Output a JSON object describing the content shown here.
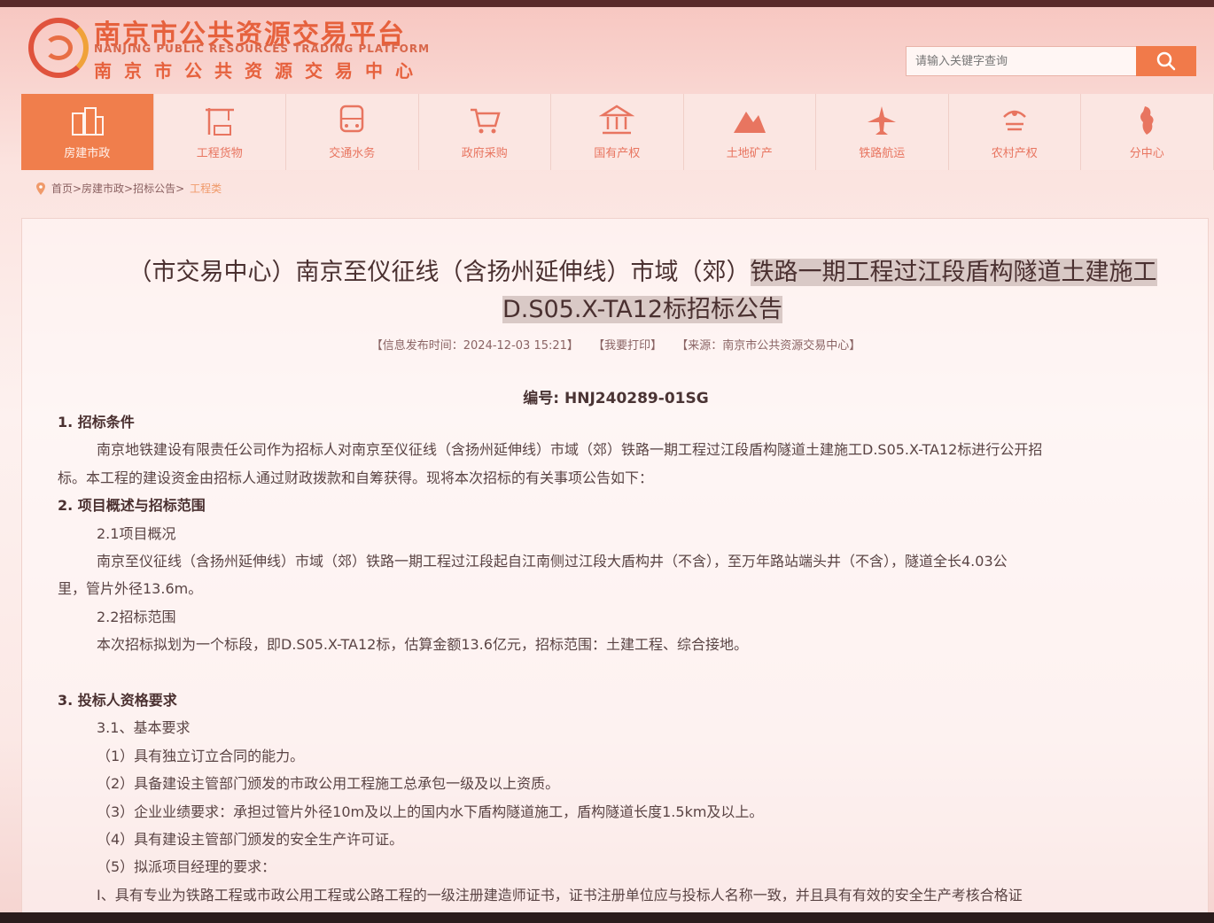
{
  "header": {
    "title_cn": "南京市公共资源交易平台",
    "title_en": "NANJING PUBLIC RESOURCES TRADING PLATFORM",
    "subtitle_cn": "南京市公共资源交易中心",
    "search_placeholder": "请输入关键字查询"
  },
  "nav": {
    "items": [
      {
        "label": "房建市政",
        "icon": "buildings-icon",
        "active": true
      },
      {
        "label": "工程货物",
        "icon": "crane-icon"
      },
      {
        "label": "交通水务",
        "icon": "bus-icon"
      },
      {
        "label": "政府采购",
        "icon": "cart-icon"
      },
      {
        "label": "国有产权",
        "icon": "bank-icon"
      },
      {
        "label": "土地矿产",
        "icon": "mountain-icon"
      },
      {
        "label": "铁路航运",
        "icon": "plane-icon"
      },
      {
        "label": "农村产权",
        "icon": "farm-icon"
      },
      {
        "label": "分中心",
        "icon": "map-icon"
      }
    ]
  },
  "breadcrumb": {
    "path": "首页>房建市政>招标公告>",
    "current": "工程类"
  },
  "article": {
    "title_part1": "（市交易中心）南京至仪征线（含扬州延伸线）市域（郊）",
    "title_part2": "铁路一期工程过江段盾构隧道土建施工",
    "title_part3": "D.S05.X-TA12标招标公告",
    "meta_time": "【信息发布时间：2024-12-03 15:21】",
    "meta_print": "【我要打印】",
    "meta_source": "【来源：南京市公共资源交易中心】",
    "doc_no": "编号: HNJ240289-01SG",
    "lines": [
      {
        "text": "1. 招标条件",
        "type": "h",
        "indent": 0
      },
      {
        "text": "南京地铁建设有限责任公司作为招标人对南京至仪征线（含扬州延伸线）市域（郊）铁路一期工程过江段盾构隧道土建施工D.S05.X-TA12标进行公开招",
        "indent": 44
      },
      {
        "text": "标。本工程的建设资金由招标人通过财政拨款和自筹获得。现将本次招标的有关事项公告如下：",
        "indent": 0
      },
      {
        "text": "2. 项目概述与招标范围",
        "type": "h",
        "indent": 0
      },
      {
        "text": "2.1项目概况",
        "indent": 44
      },
      {
        "text": "南京至仪征线（含扬州延伸线）市域（郊）铁路一期工程过江段起自江南侧过江段大盾构井（不含），至万年路站端头井（不含），隧道全长4.03公",
        "indent": 44
      },
      {
        "text": "里，管片外径13.6m。",
        "indent": 0
      },
      {
        "text": "2.2招标范围",
        "indent": 44
      },
      {
        "text": "本次招标拟划为一个标段，即D.S05.X-TA12标，估算金额13.6亿元，招标范围：土建工程、综合接地。",
        "indent": 44
      },
      {
        "text": "",
        "indent": 0
      },
      {
        "text": "3. 投标人资格要求",
        "type": "h",
        "indent": 0
      },
      {
        "text": "3.1、基本要求",
        "indent": 44
      },
      {
        "text": "（1）具有独立订立合同的能力。",
        "indent": 44
      },
      {
        "text": "（2）具备建设主管部门颁发的市政公用工程施工总承包一级及以上资质。",
        "indent": 44
      },
      {
        "text": "（3）企业业绩要求：承担过管片外径10m及以上的国内水下盾构隧道施工，盾构隧道长度1.5km及以上。",
        "indent": 44
      },
      {
        "text": "（4）具有建设主管部门颁发的安全生产许可证。",
        "indent": 44
      },
      {
        "text": "（5）拟派项目经理的要求：",
        "indent": 44
      },
      {
        "text": "Ⅰ、具有专业为铁路工程或市政公用工程或公路工程的一级注册建造师证书，证书注册单位应与投标人名称一致，并且具有有效的安全生产考核合格证",
        "indent": 44
      }
    ]
  },
  "colors": {
    "accent": "#f07e4c",
    "brand": "#e6613d"
  }
}
